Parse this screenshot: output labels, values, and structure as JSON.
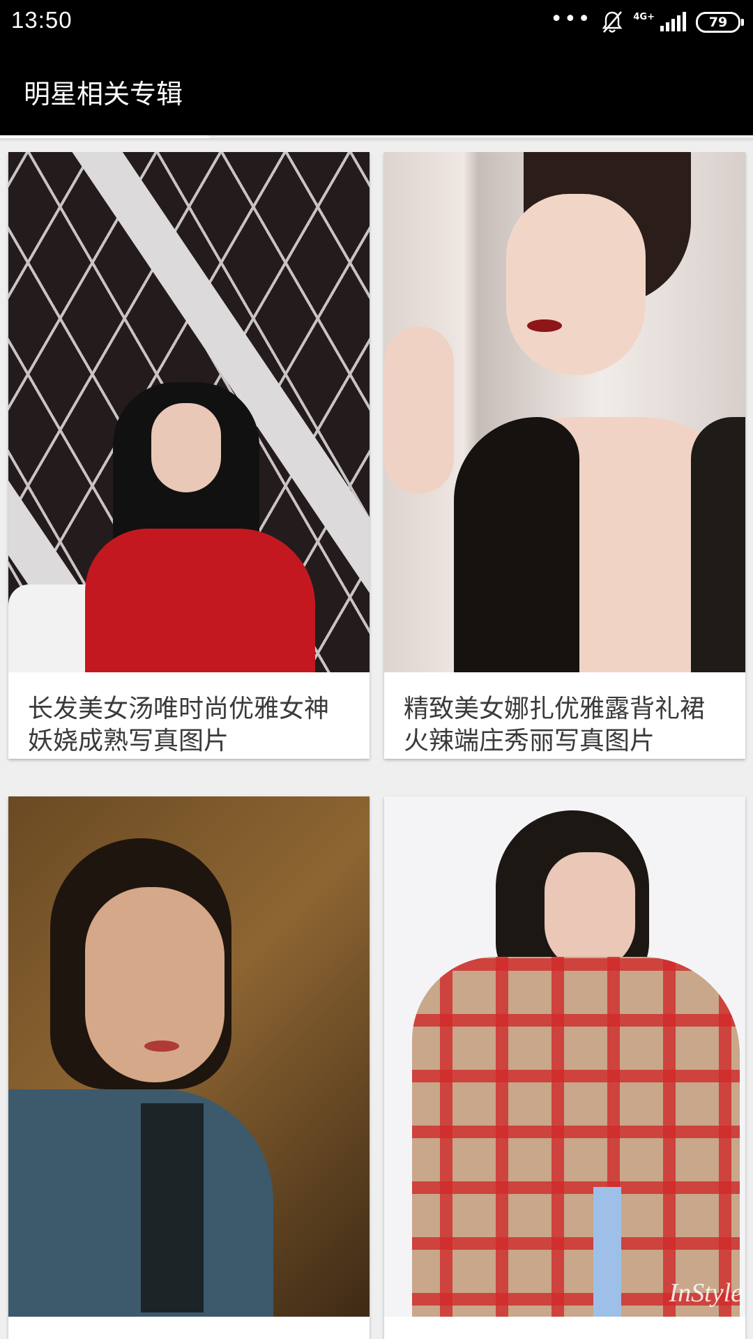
{
  "status_bar": {
    "time": "13:50",
    "network_label": "4G+",
    "battery": "79"
  },
  "app_bar": {
    "title": "明星相关专辑"
  },
  "albums": [
    {
      "caption": "长发美女汤唯时尚优雅女神妖娆成熟写真图片"
    },
    {
      "caption": "精致美女娜扎优雅露背礼裙火辣端庄秀丽写真图片"
    },
    {
      "caption": ""
    },
    {
      "caption": ""
    }
  ],
  "watermark": "InStyle"
}
